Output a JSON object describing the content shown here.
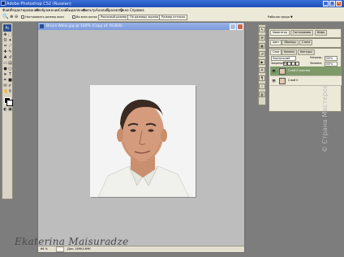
{
  "app": {
    "title": "Adobe Photoshop CS2 (Russian)",
    "logo": "Ps"
  },
  "menu": [
    "Файл",
    "Редактирование",
    "Изображение",
    "Слой",
    "Выделение",
    "Фильтр",
    "Анализ",
    "Просмотр",
    "Окно",
    "Справка"
  ],
  "options_bar": {
    "resize_windows_label": "Настраивать размер окон",
    "all_windows_label": "Во всех окнах",
    "buttons": [
      "Реальный размер",
      "По размеру экрана",
      "Размер оттиска"
    ],
    "workspace_label": "Рабочая среда ▼"
  },
  "document": {
    "title": "Bruce Willis.jpg @ 100% (Copy of, RGB/8)",
    "status_zoom": "66 %",
    "status_doc": "Док: 169К/169К"
  },
  "panels": {
    "navigator_tabs": [
      "Навигатор",
      "Гистограмма",
      "Инфо"
    ],
    "color_tabs": [
      "Цвет",
      "Образцы",
      "Стили"
    ],
    "layers_tabs": [
      "Слои",
      "Каналы",
      "Контуры"
    ],
    "blend_mode": "Нормальный",
    "opacity_label": "Непрозр.:",
    "opacity_value": "100%",
    "lock_label": "Закрепить:",
    "fill_label": "Заливка:",
    "fill_value": "100%",
    "layers": [
      {
        "name": "Слой 0 (копия)",
        "selected": true
      },
      {
        "name": "Слой 0",
        "selected": false
      }
    ]
  },
  "signature": "Ekaterina Maisuradze",
  "watermark": "© Страна Мастеров"
}
